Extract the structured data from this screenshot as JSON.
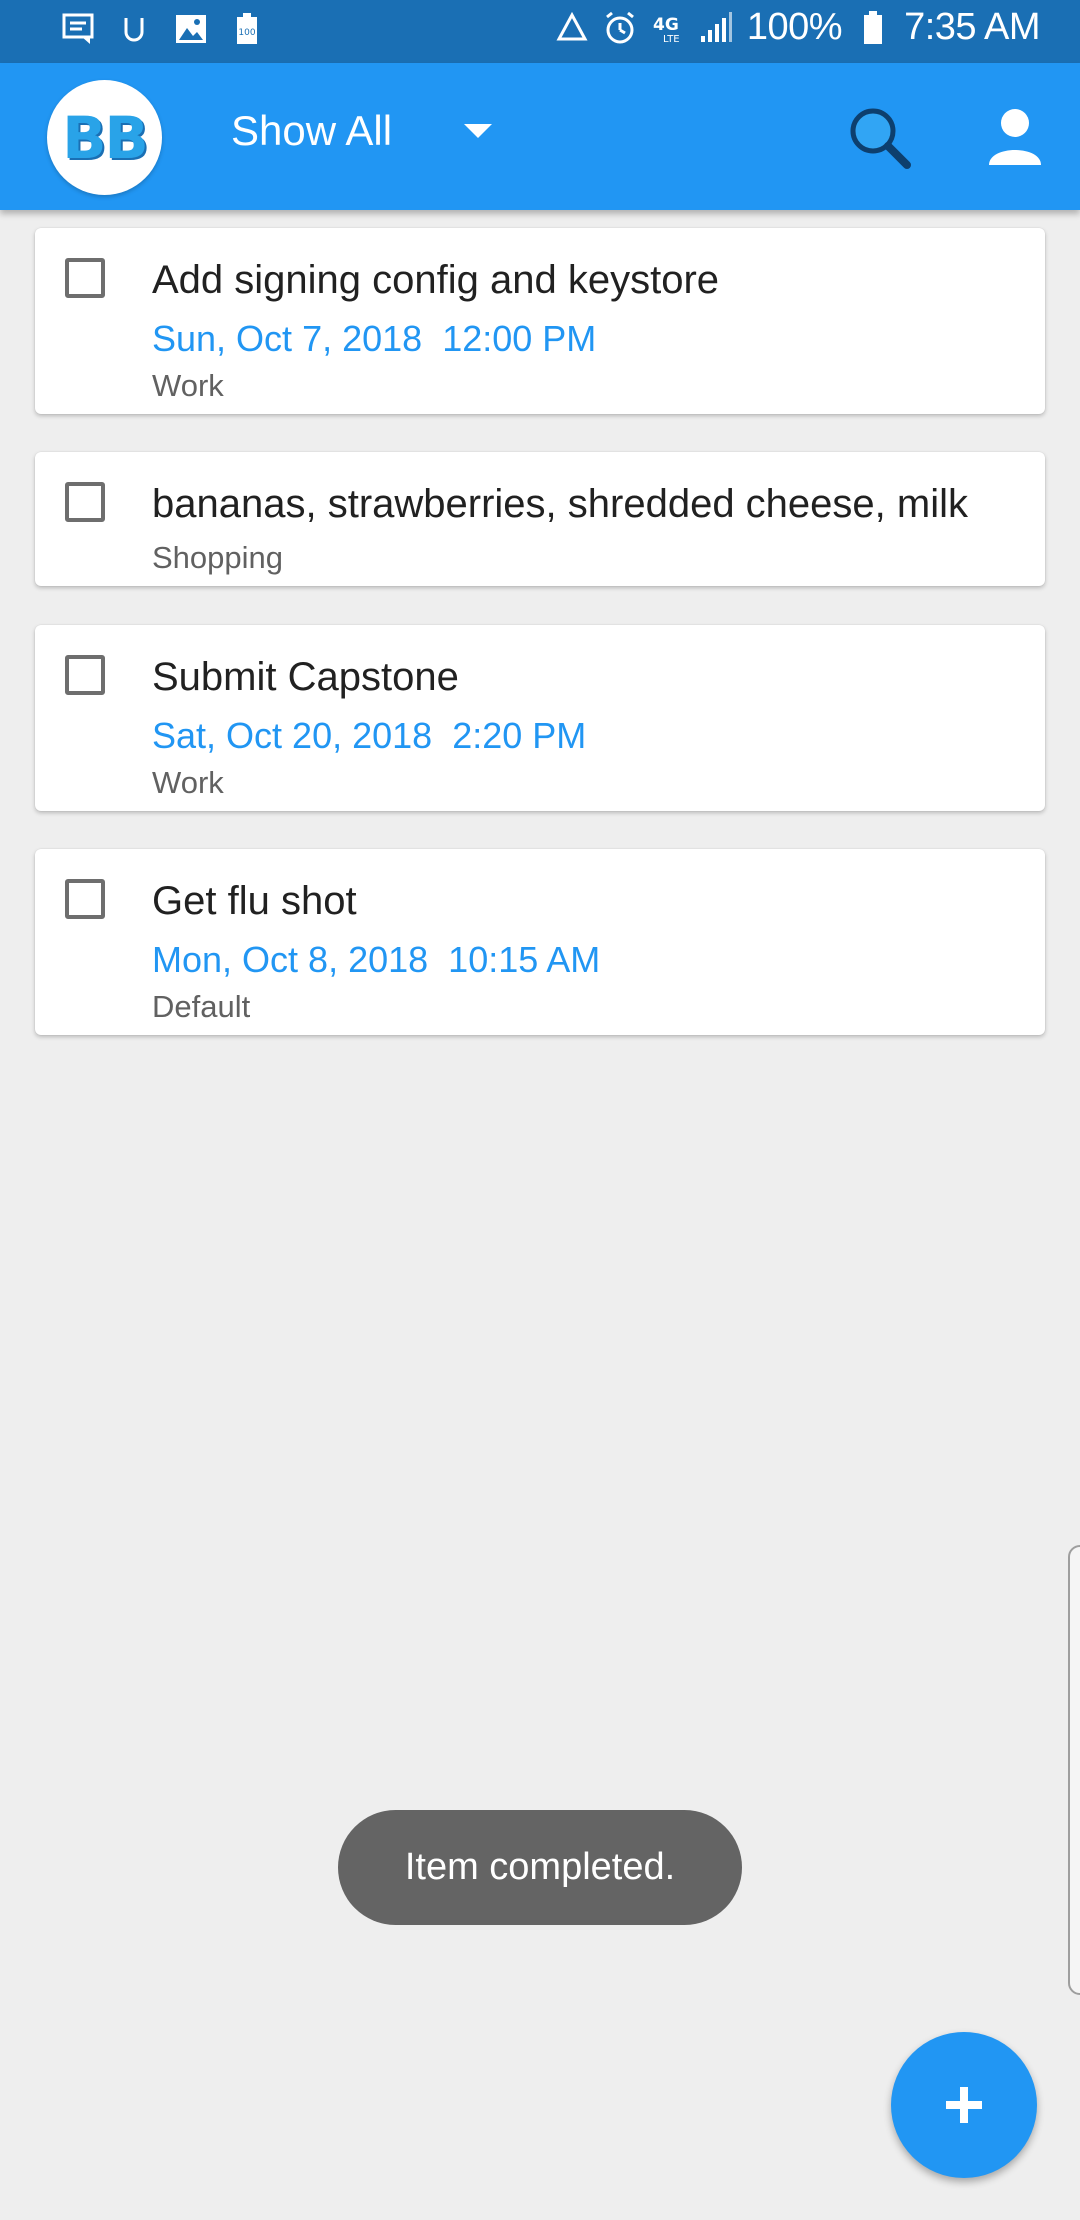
{
  "status_bar": {
    "left_icons": [
      "messages-icon",
      "upwork-icon",
      "gallery-icon",
      "battery-saver-icon"
    ],
    "right_icons": [
      "recycle-icon",
      "alarm-icon",
      "4g-lte-icon",
      "signal-icon"
    ],
    "battery_percent": "100%",
    "time": "7:35 AM"
  },
  "app_bar": {
    "logo_text": "BB",
    "filter_label": "Show All",
    "icons": [
      "search-icon",
      "account-icon"
    ]
  },
  "tasks": [
    {
      "title": "Add signing config and keystore",
      "date": "Sun, Oct 7, 2018",
      "time": "12:00 PM",
      "category": "Work"
    },
    {
      "title": "bananas, strawberries,  shredded cheese,  milk",
      "category": "Shopping"
    },
    {
      "title": "Submit Capstone",
      "date": "Sat, Oct 20, 2018",
      "time": "2:20 PM",
      "category": "Work"
    },
    {
      "title": "Get flu shot",
      "date": "Mon, Oct 8, 2018",
      "time": "10:15 AM",
      "category": "Default"
    }
  ],
  "toast": {
    "message": "Item completed."
  },
  "fab": {
    "icon": "plus-icon"
  },
  "colors": {
    "primary": "#2196f3",
    "status_bar": "#1a6fb4",
    "background": "#eeeeee",
    "date_text": "#2196f3"
  }
}
